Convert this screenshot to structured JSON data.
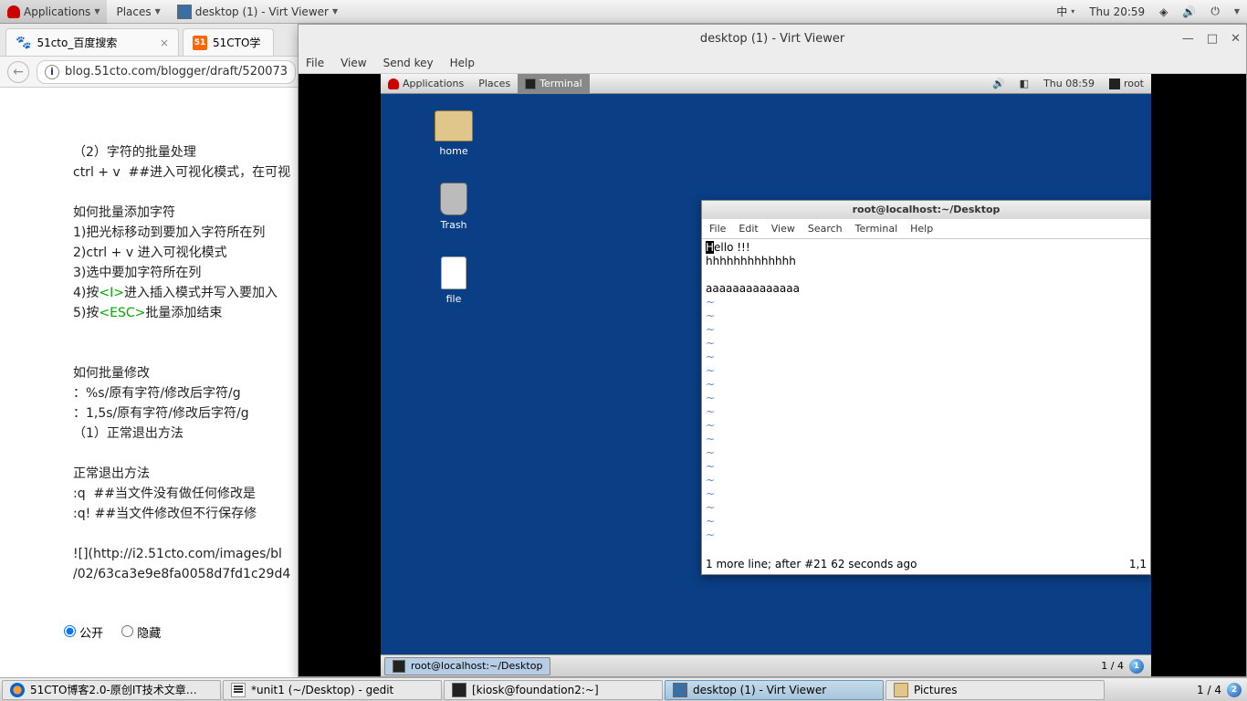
{
  "host_panel": {
    "applications": "Applications",
    "places": "Places",
    "active_task": "desktop (1) - Virt Viewer",
    "ime": "中",
    "clock": "Thu 20:59"
  },
  "browser": {
    "tab1": "51cto_百度搜索",
    "tab2": "51CTO学",
    "url": "blog.51cto.com/blogger/draft/520073",
    "lines": {
      "l1": "（2）字符的批量处理",
      "l2": "ctrl + v  ##进入可视化模式，在可视",
      "l3": "如何批量添加字符",
      "l4": "1)把光标移动到要加入字符所在列",
      "l5": "2)ctrl + v 进入可视化模式",
      "l6": "3)选中要加字符所在列",
      "l7a": "4)按",
      "l7b": "<I>",
      "l7c": "进入插入模式并写入要加入",
      "l8a": "5)按",
      "l8b": "<ESC>",
      "l8c": "批量添加结束",
      "l9": "如何批量修改",
      "l10": "：%s/原有字符/修改后字符/g",
      "l11": "：1,5s/原有字符/修改后字符/g",
      "l12": "（1）正常退出方法",
      "l13": "正常退出方法",
      "l14": ":q  ##当文件没有做任何修改是",
      "l15": ":q! ##当文件修改但不行保存修",
      "l16": "![](http://i2.51cto.com/images/bl",
      "l17": "/02/63ca3e9e8fa0058d7fd1c29d4"
    },
    "radio1": "公开",
    "radio2": "隐藏"
  },
  "virt": {
    "title": "desktop (1) - Virt Viewer",
    "menu": {
      "file": "File",
      "view": "View",
      "sendkey": "Send key",
      "help": "Help"
    }
  },
  "guest_panel": {
    "applications": "Applications",
    "places": "Places",
    "terminal": "Terminal",
    "clock": "Thu 08:59",
    "user": "root"
  },
  "desktop_icons": {
    "home": "home",
    "trash": "Trash",
    "file": "file"
  },
  "terminal": {
    "title": "root@localhost:~/Desktop",
    "menu": {
      "file": "File",
      "edit": "Edit",
      "view": "View",
      "search": "Search",
      "terminal": "Terminal",
      "help": "Help"
    },
    "line1a": "H",
    "line1b": "ello !!!",
    "line2": "hhhhhhhhhhhhh",
    "line3": "aaaaaaaaaaaaaa",
    "status_left": "1 more line; after #21  62 seconds ago",
    "status_right": "1,1"
  },
  "guest_taskbar": {
    "task": "root@localhost:~/Desktop",
    "workspace": "1 / 4",
    "badge": "1"
  },
  "host_taskbar": {
    "t1": "51CTO博客2.0-原创IT技术文章…",
    "t2": "*unit1 (~/Desktop) - gedit",
    "t3": "[kiosk@foundation2:~]",
    "t4": "desktop (1) - Virt Viewer",
    "t5": "Pictures",
    "workspace": "1 / 4",
    "badge": "2"
  }
}
